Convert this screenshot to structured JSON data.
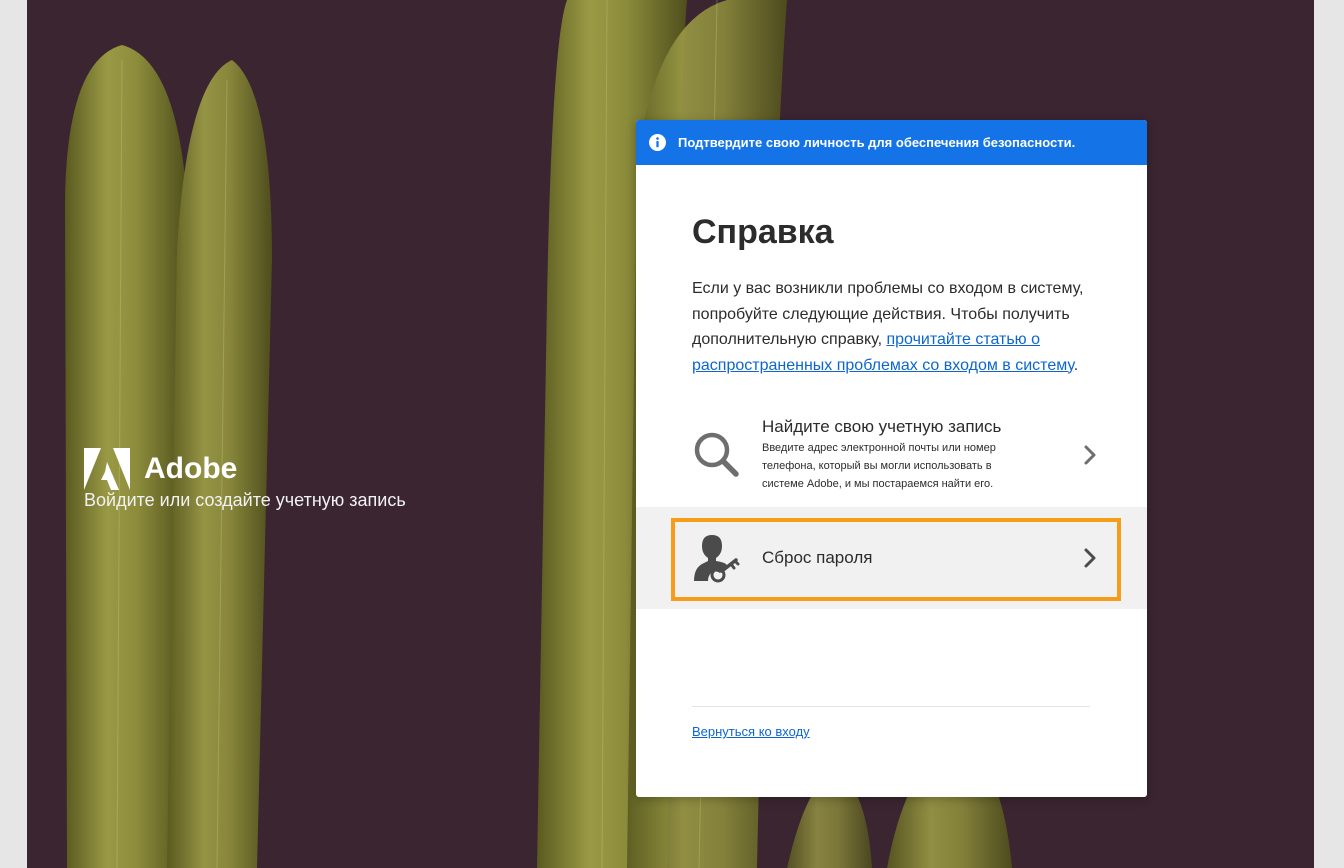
{
  "brand": {
    "name": "Adobe",
    "tagline": "Войдите или создайте учетную запись"
  },
  "banner": {
    "icon": "info-icon",
    "text": "Подтвердите свою личность для обеспечения безопасности."
  },
  "help": {
    "title": "Справка",
    "description_prefix": "Если у вас возникли проблемы со входом в систему, попробуйте следующие действия. Чтобы получить дополнительную справку, ",
    "description_link": "прочитайте статью о распространенных проблемах со входом в систему",
    "description_suffix": "."
  },
  "options": {
    "find_account": {
      "icon": "search-icon",
      "title": "Найдите свою учетную запись",
      "subtitle": "Введите адрес электронной почты или номер телефона, который вы могли использовать в системе Adobe, и мы постараемся найти его."
    },
    "reset_password": {
      "icon": "user-key-icon",
      "title": "Сброс пароля"
    }
  },
  "footer": {
    "back_link": "Вернуться ко входу"
  },
  "colors": {
    "banner": "#1473e6",
    "link": "#0d66d0",
    "highlight": "#f59d18",
    "background": "#3a2530",
    "cactus": "#8a8a3a"
  }
}
